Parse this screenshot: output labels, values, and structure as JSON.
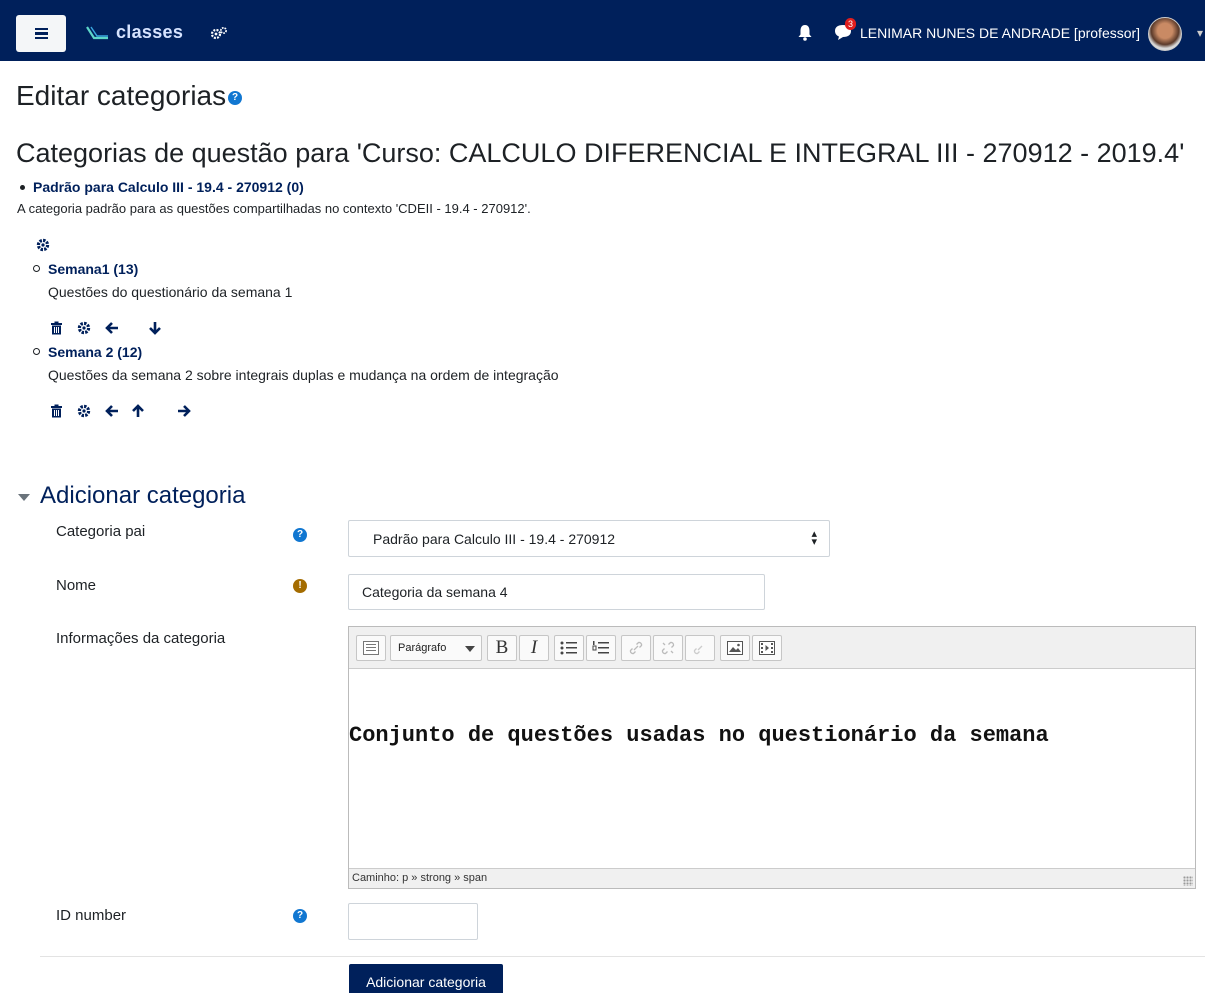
{
  "navbar": {
    "brand": "classes",
    "notifications_badge": "3",
    "user_label": "LENIMAR NUNES DE ANDRADE [professor]",
    "colors": {
      "bar": "#00205b",
      "brand_text": "#d6e3ff"
    }
  },
  "page": {
    "title": "Editar categorias",
    "help_glyph": "?",
    "section_heading": "Categorias de questão para 'Curso: CALCULO DIFERENCIAL E INTEGRAL III - 270912 - 2019.4'"
  },
  "categories": [
    {
      "name": "Padrão para Calculo III - 19.4 - 270912 (0)",
      "description": "A categoria padrão para as questões compartilhadas no contexto 'CDEII - 19.4 - 270912'.",
      "actions": [
        "edit-icon"
      ]
    },
    {
      "name": "Semana1 (13)",
      "description": "Questões do questionário da semana 1",
      "actions": [
        "delete-icon",
        "edit-icon",
        "move-left-icon",
        "move-down-icon"
      ]
    },
    {
      "name": "Semana 2 (12)",
      "description": "Questões da semana 2 sobre integrais duplas e mudança na ordem de integração",
      "actions": [
        "delete-icon",
        "edit-icon",
        "move-left-icon",
        "move-up-icon",
        "move-right-icon"
      ]
    }
  ],
  "form": {
    "legend": "Adicionar categoria",
    "parent_label": "Categoria pai",
    "parent_value": "Padrão para Calculo III - 19.4 - 270912",
    "name_label": "Nome",
    "name_value": "Categoria da semana 4",
    "info_label": "Informações da categoria",
    "editor": {
      "format_select": "Parágrafo",
      "bold": "B",
      "italic": "I",
      "content": "Conjunto de questões usadas no questionário da semana",
      "path": "Caminho: p » strong » span"
    },
    "idnumber_label": "ID number",
    "idnumber_value": "",
    "submit_label": "Adicionar categoria",
    "help_glyph": "?",
    "required_glyph": "!"
  }
}
